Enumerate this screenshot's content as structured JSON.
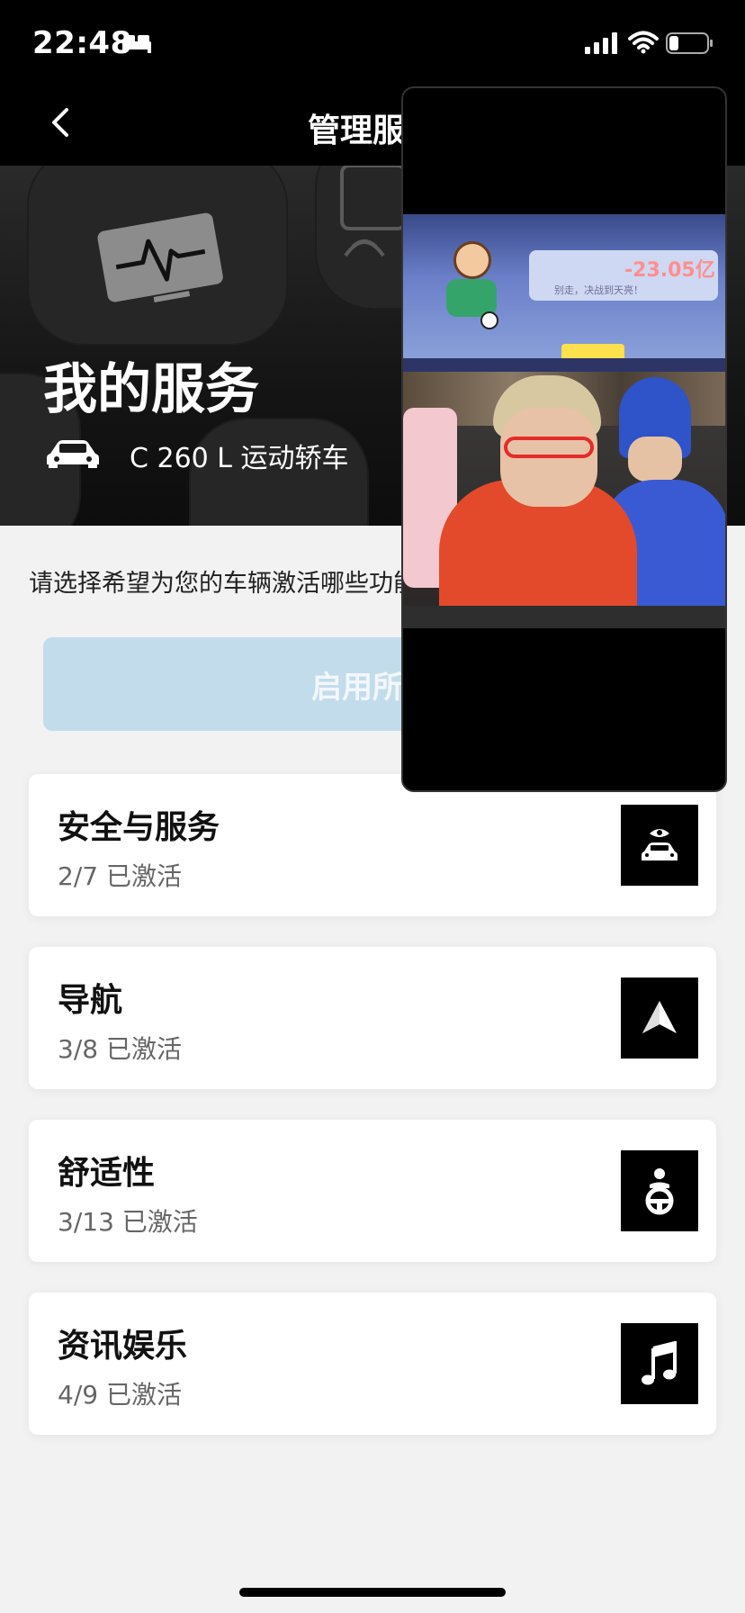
{
  "status_bar": {
    "time": "22:48"
  },
  "nav": {
    "title": "管理服务"
  },
  "hero": {
    "title": "我的服务",
    "model": "C 260 L 运动轿车"
  },
  "instruction": "请选择希望为您的车辆激活哪些功能",
  "enable_all_label": "启用所有",
  "services": [
    {
      "title": "安全与服务",
      "status": "2/7 已激活",
      "icon": "car-eye-icon"
    },
    {
      "title": "导航",
      "status": "3/8 已激活",
      "icon": "navigation-arrow-icon"
    },
    {
      "title": "舒适性",
      "status": "3/13 已激活",
      "icon": "seat-steering-icon"
    },
    {
      "title": "资讯娱乐",
      "status": "4/9 已激活",
      "icon": "music-note-icon"
    }
  ],
  "pip": {
    "game_score": "-23.05亿",
    "game_subtitle": "别走，决战到天亮！"
  },
  "colors": {
    "enable_all_bg": "#c3dcec",
    "background": "#f2f2f2"
  }
}
